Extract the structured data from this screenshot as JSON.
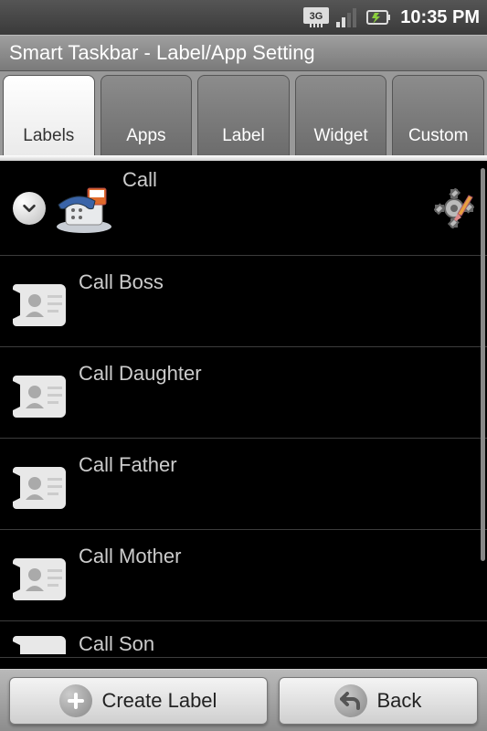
{
  "status": {
    "time": "10:35 PM"
  },
  "title": "Smart Taskbar - Label/App Setting",
  "tabs": [
    {
      "label": "Labels",
      "active": true
    },
    {
      "label": "Apps"
    },
    {
      "label": "Label"
    },
    {
      "label": "Widget"
    },
    {
      "label": "Custom"
    }
  ],
  "list": {
    "header": {
      "label": "Call"
    },
    "items": [
      {
        "label": "Call Boss"
      },
      {
        "label": "Call Daughter"
      },
      {
        "label": "Call Father"
      },
      {
        "label": "Call Mother"
      },
      {
        "label": "Call Son"
      }
    ]
  },
  "buttons": {
    "create": "Create Label",
    "back": "Back"
  }
}
